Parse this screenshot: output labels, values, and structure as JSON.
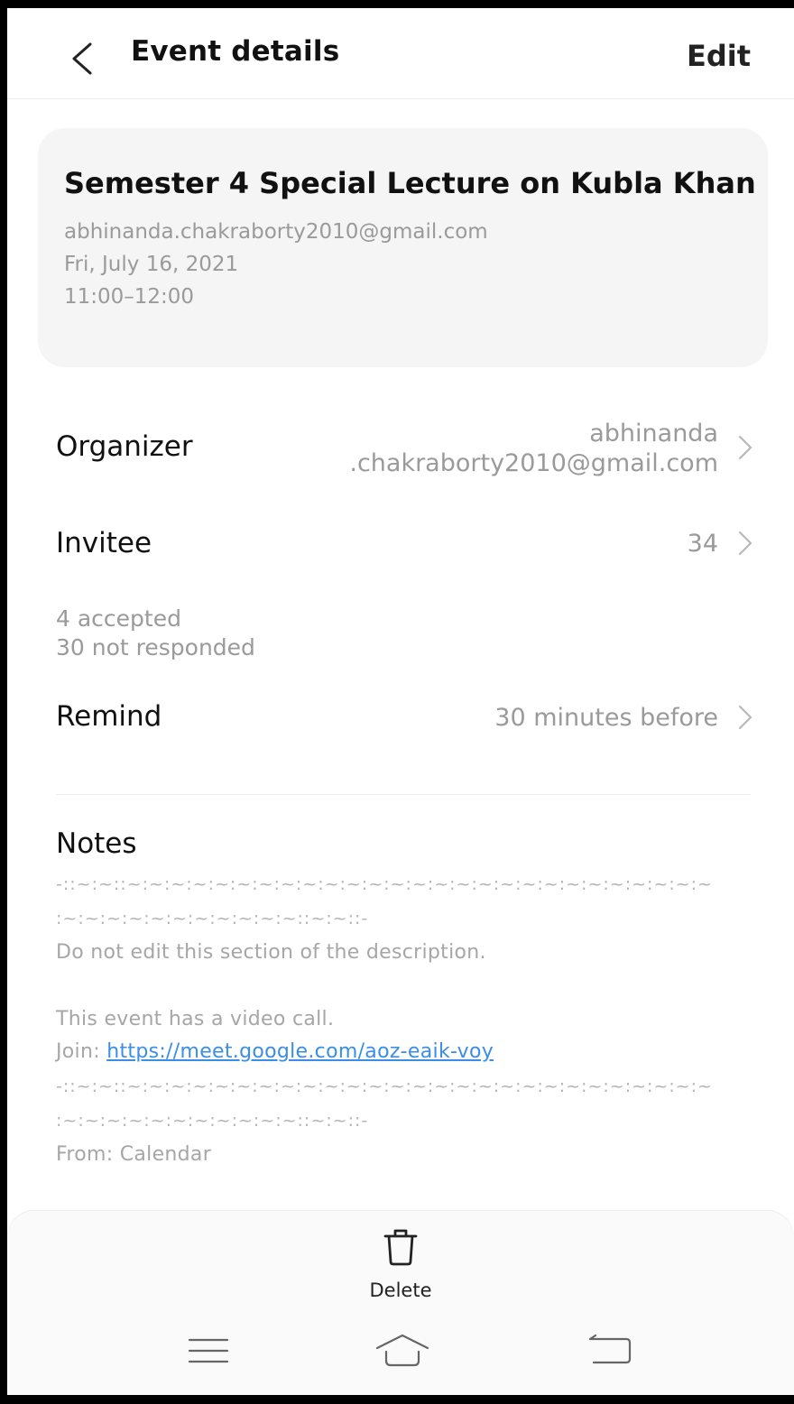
{
  "header": {
    "title": "Event details",
    "edit_label": "Edit"
  },
  "event": {
    "title": "Semester 4 Special Lecture on Kubla Khan",
    "account": "abhinanda.chakraborty2010@gmail.com",
    "date": "Fri, July 16, 2021",
    "time": "11:00–12:00"
  },
  "organizer": {
    "label": "Organizer",
    "value_line1": "abhinanda",
    "value_line2": ".chakraborty2010@gmail.com"
  },
  "invitee": {
    "label": "Invitee",
    "count": "34",
    "accepted": "4 accepted",
    "not_responded": "30 not responded"
  },
  "remind": {
    "label": "Remind",
    "value": "30 minutes before"
  },
  "notes": {
    "title": "Notes",
    "separator_line1": "-::~:~::~:~:~:~:~:~:~:~:~:~:~:~:~:~:~:~:~:~:~:~:~:~:~:~:~:~:~",
    "separator_line2": ":~:~:~:~:~:~:~:~:~:~:~::~:~::-",
    "warning": "Do not edit this section of the description.",
    "video_call": "This event has a video call.",
    "join_prefix": "Join: ",
    "join_link": "https://meet.google.com/aoz-eaik-voy",
    "separator_line3": "-::~:~::~:~:~:~:~:~:~:~:~:~:~:~:~:~:~:~:~:~:~:~:~:~:~:~:~:~:~",
    "separator_line4": ":~:~:~:~:~:~:~:~:~:~:~::~:~::-",
    "from": "From: Calendar"
  },
  "actions": {
    "delete_label": "Delete"
  },
  "icons": {
    "back": "chevron-left-icon",
    "chevron": "chevron-right-icon",
    "delete": "trash-icon",
    "menu": "menu-icon",
    "home": "home-icon",
    "return": "back-icon"
  },
  "colors": {
    "link": "#3a8ee6",
    "secondary_text": "#9a9a9a",
    "card_bg": "#f5f5f5"
  }
}
